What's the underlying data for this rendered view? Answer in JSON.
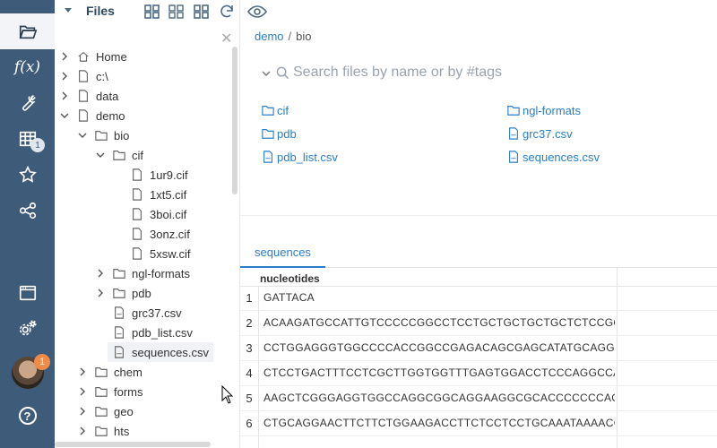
{
  "sidebar": {
    "items": [
      {
        "name": "browse",
        "icon": "folder-open-icon"
      },
      {
        "name": "functions",
        "icon": "function-icon",
        "glyph": "f(x)"
      },
      {
        "name": "tools",
        "icon": "wrench-icon"
      },
      {
        "name": "tables",
        "icon": "table-icon",
        "badge": "1"
      },
      {
        "name": "favorites",
        "icon": "star-icon"
      },
      {
        "name": "share",
        "icon": "share-icon"
      },
      {
        "name": "windows",
        "icon": "window-icon"
      },
      {
        "name": "settings",
        "icon": "gears-icon"
      },
      {
        "name": "user",
        "icon": "avatar",
        "badge": "1"
      },
      {
        "name": "help",
        "icon": "help-icon",
        "glyph": "?"
      }
    ]
  },
  "tree": {
    "title": "Files",
    "nodes": [
      {
        "label": "Home",
        "icon": "home-icon"
      },
      {
        "label": "c:\\",
        "icon": "file-icon"
      },
      {
        "label": "data",
        "icon": "file-icon"
      },
      {
        "label": "demo",
        "icon": "file-icon"
      },
      {
        "label": "bio",
        "icon": "folder-icon"
      },
      {
        "label": "cif",
        "icon": "folder-icon"
      },
      {
        "label": "1ur9.cif",
        "icon": "file-icon"
      },
      {
        "label": "1xt5.cif",
        "icon": "file-icon"
      },
      {
        "label": "3boi.cif",
        "icon": "file-icon"
      },
      {
        "label": "3onz.cif",
        "icon": "file-icon"
      },
      {
        "label": "5xsw.cif",
        "icon": "file-icon"
      },
      {
        "label": "ngl-formats",
        "icon": "folder-icon"
      },
      {
        "label": "pdb",
        "icon": "folder-icon"
      },
      {
        "label": "grc37.csv",
        "icon": "csv-icon"
      },
      {
        "label": "pdb_list.csv",
        "icon": "csv-icon"
      },
      {
        "label": "sequences.csv",
        "icon": "csv-icon"
      },
      {
        "label": "chem",
        "icon": "folder-icon"
      },
      {
        "label": "forms",
        "icon": "folder-icon"
      },
      {
        "label": "geo",
        "icon": "folder-icon"
      },
      {
        "label": "hts",
        "icon": "folder-icon"
      }
    ]
  },
  "breadcrumb": {
    "part1": "demo",
    "sep": "/",
    "part2": "bio"
  },
  "search": {
    "placeholder": "Search files by name or by #tags"
  },
  "files": {
    "left": [
      {
        "label": "cif",
        "icon": "folder-icon"
      },
      {
        "label": "pdb",
        "icon": "folder-icon"
      },
      {
        "label": "pdb_list.csv",
        "icon": "csv-icon"
      }
    ],
    "right": [
      {
        "label": "ngl-formats",
        "icon": "folder-icon"
      },
      {
        "label": "grc37.csv",
        "icon": "csv-icon"
      },
      {
        "label": "sequences.csv",
        "icon": "csv-icon"
      }
    ]
  },
  "tab": {
    "label": "sequences"
  },
  "grid": {
    "column": "nucleotides",
    "rows": [
      {
        "n": "1",
        "v": "GATTACA"
      },
      {
        "n": "2",
        "v": "ACAAGATGCCATTGTCCCCCGGCCTCCTGCTGCTGCTGCTCTCCGGGGCCACGG"
      },
      {
        "n": "3",
        "v": "CCTGGAGGGTGGCCCCACCGGCCGAGACAGCGAGCATATGCAGGAAGCGGCAG"
      },
      {
        "n": "4",
        "v": "CTCCTGACTTTCCTCGCTTGGTGGTTTGAGTGGACCTCCCAGGCCAGTGCCGG"
      },
      {
        "n": "5",
        "v": "AAGCTCGGGAGGTGGCCAGGCGGCAGGAAGGCGCACCCCCCCAGCAATCCGCG"
      },
      {
        "n": "6",
        "v": "CTGCAGGAACTTCTTCTGGAAGACCTTCTCCTCCTGCAAATAAAACCTCACCCA"
      }
    ]
  },
  "colors": {
    "sidebar_bg": "#3e5b7a",
    "accent": "#2a7ec7",
    "badge_orange": "#f08a47"
  }
}
